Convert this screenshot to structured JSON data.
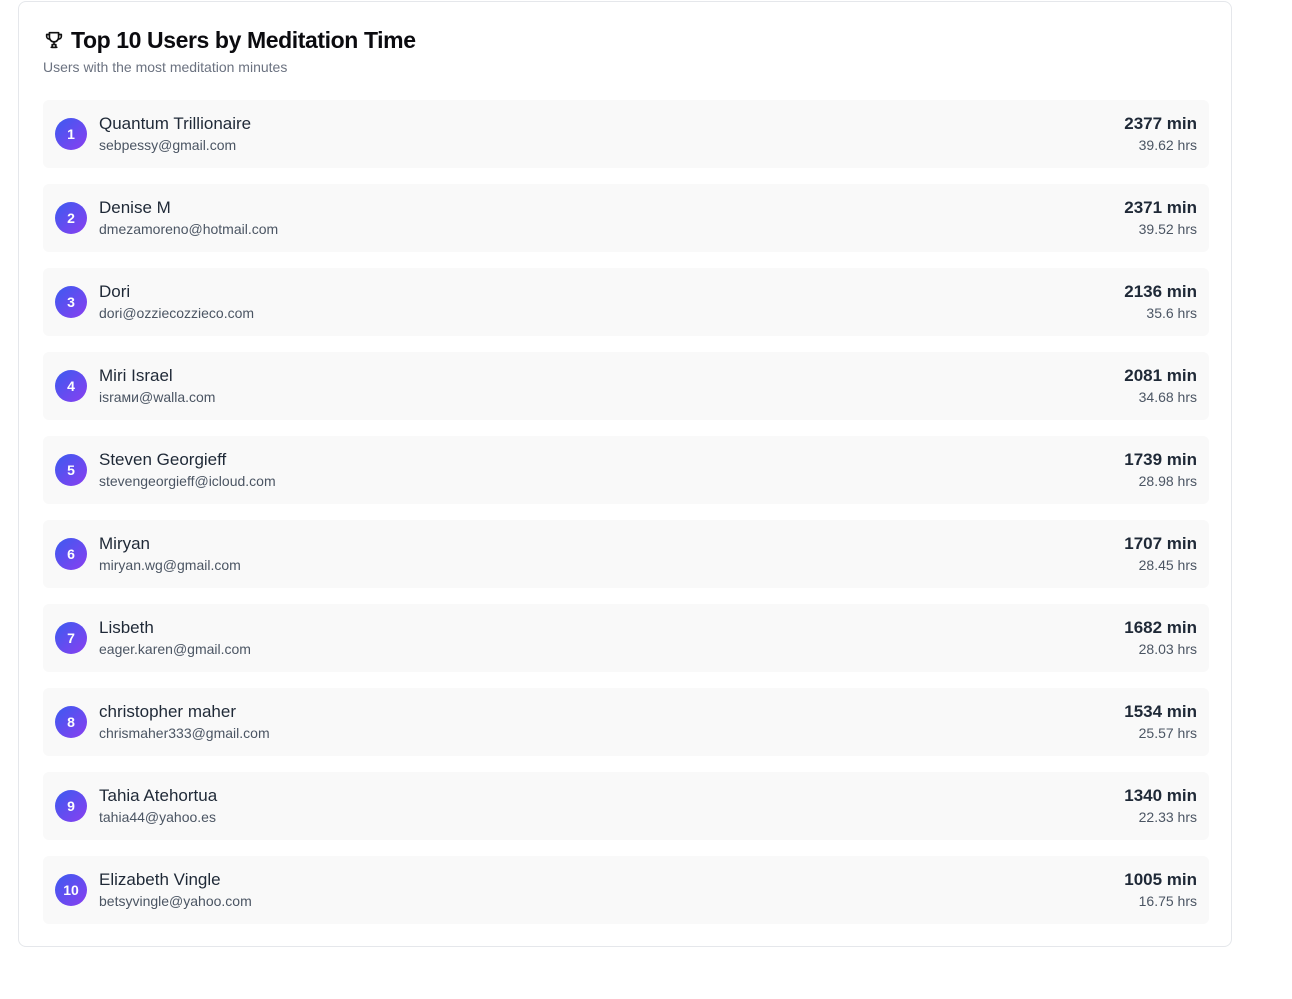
{
  "header": {
    "icon": "trophy-icon",
    "title": "Top 10 Users by Meditation Time",
    "subtitle": "Users with the most meditation minutes"
  },
  "colors": {
    "badge_gradient_start": "#3b5bf0",
    "badge_gradient_end": "#8a3ff0",
    "row_background": "#f9f9f9"
  },
  "users": [
    {
      "rank": "1",
      "name": "Quantum Trillionaire",
      "email": "sebpessy@gmail.com",
      "minutes": "2377 min",
      "hours": "39.62 hrs"
    },
    {
      "rank": "2",
      "name": "Denise M",
      "email": "dmezamoreno@hotmail.com",
      "minutes": "2371 min",
      "hours": "39.52 hrs"
    },
    {
      "rank": "3",
      "name": "Dori",
      "email": "dori@ozziecozzieco.com",
      "minutes": "2136 min",
      "hours": "35.6 hrs"
    },
    {
      "rank": "4",
      "name": "Miri Israel",
      "email": "israми@walla.com",
      "minutes": "2081 min",
      "hours": "34.68 hrs"
    },
    {
      "rank": "5",
      "name": "Steven Georgieff",
      "email": "stevengeorgieff@icloud.com",
      "minutes": "1739 min",
      "hours": "28.98 hrs"
    },
    {
      "rank": "6",
      "name": "Miryan",
      "email": "miryan.wg@gmail.com",
      "minutes": "1707 min",
      "hours": "28.45 hrs"
    },
    {
      "rank": "7",
      "name": "Lisbeth",
      "email": "eager.karen@gmail.com",
      "minutes": "1682 min",
      "hours": "28.03 hrs"
    },
    {
      "rank": "8",
      "name": "christopher maher",
      "email": "chrismaher333@gmail.com",
      "minutes": "1534 min",
      "hours": "25.57 hrs"
    },
    {
      "rank": "9",
      "name": "Tahia Atehortua",
      "email": "tahia44@yahoo.es",
      "minutes": "1340 min",
      "hours": "22.33 hrs"
    },
    {
      "rank": "10",
      "name": "Elizabeth Vingle",
      "email": "betsyvingle@yahoo.com",
      "minutes": "1005 min",
      "hours": "16.75 hrs"
    }
  ]
}
